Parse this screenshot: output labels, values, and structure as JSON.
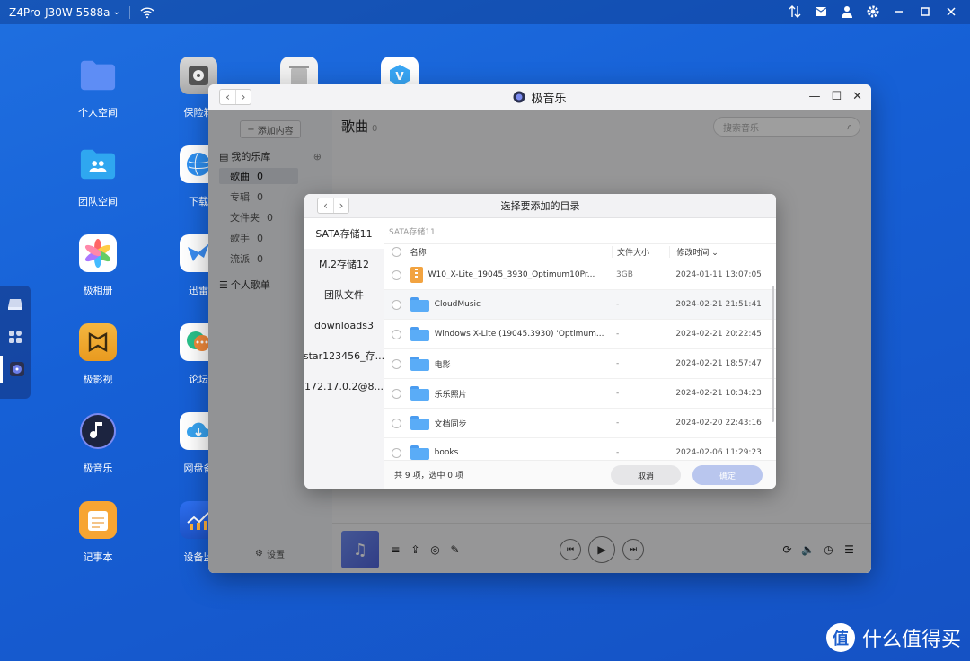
{
  "topbar": {
    "device_name": "Z4Pro-J30W-5588a",
    "chevron": "⌄"
  },
  "desktop": {
    "icons": [
      {
        "label": "个人空间"
      },
      {
        "label": "保险箱"
      },
      {
        "label": "团队空间"
      },
      {
        "label": "下载"
      },
      {
        "label": "极相册"
      },
      {
        "label": "迅雷"
      },
      {
        "label": "极影视"
      },
      {
        "label": "论坛"
      },
      {
        "label": "极音乐"
      },
      {
        "label": "网盘备"
      },
      {
        "label": "记事本"
      },
      {
        "label": "设备监"
      }
    ]
  },
  "music_app": {
    "title": "极音乐",
    "add_button": "添加内容",
    "library_header": "我的乐库",
    "library_items": [
      {
        "label": "歌曲",
        "count": "0"
      },
      {
        "label": "专辑",
        "count": "0"
      },
      {
        "label": "文件夹",
        "count": "0"
      },
      {
        "label": "歌手",
        "count": "0"
      },
      {
        "label": "流派",
        "count": "0"
      }
    ],
    "playlist_header": "个人歌单",
    "settings_label": "设置",
    "main_title": "歌曲",
    "main_count": "0",
    "search_placeholder": "搜索音乐"
  },
  "dialog": {
    "title": "选择要添加的目录",
    "locations": [
      "SATA存储11",
      "M.2存储12",
      "团队文件",
      "downloads3",
      "star123456_存...",
      "172.17.0.2@8..."
    ],
    "breadcrumb": "SATA存储11",
    "columns": {
      "name": "名称",
      "size": "文件大小",
      "date": "修改时间"
    },
    "rows": [
      {
        "name": "W10_X-Lite_19045_3930_Optimum10Pr...",
        "size": "3GB",
        "date": "2024-01-11 13:07:05",
        "type": "zip"
      },
      {
        "name": "CloudMusic",
        "size": "-",
        "date": "2024-02-21 21:51:41",
        "type": "folder"
      },
      {
        "name": "Windows X-Lite (19045.3930) 'Optimum...",
        "size": "-",
        "date": "2024-02-21 20:22:45",
        "type": "folder"
      },
      {
        "name": "电影",
        "size": "-",
        "date": "2024-02-21 18:57:47",
        "type": "folder"
      },
      {
        "name": "乐乐照片",
        "size": "-",
        "date": "2024-02-21 10:34:23",
        "type": "folder"
      },
      {
        "name": "文档同步",
        "size": "-",
        "date": "2024-02-20 22:43:16",
        "type": "folder"
      },
      {
        "name": "books",
        "size": "-",
        "date": "2024-02-06 11:29:23",
        "type": "folder"
      }
    ],
    "footer_status": "共 9 项，选中 0 项",
    "cancel_label": "取消",
    "confirm_label": "确定"
  },
  "watermark": {
    "text": "什么值得买",
    "logo_text": "值"
  }
}
